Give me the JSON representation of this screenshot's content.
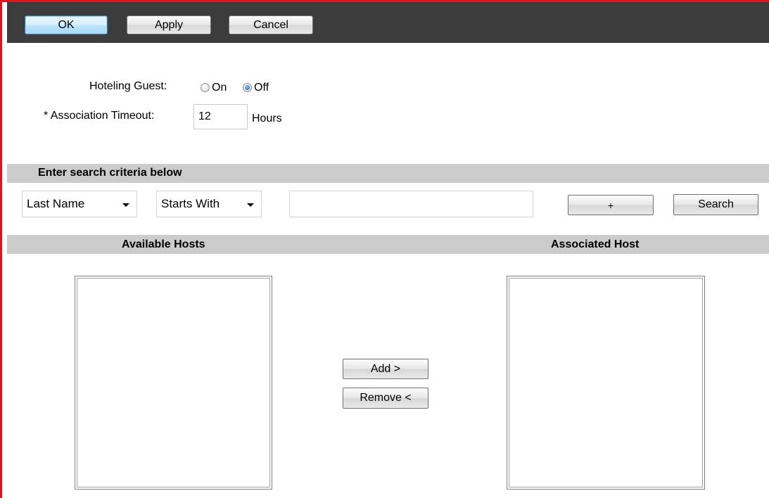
{
  "toolbar": {
    "ok_label": "OK",
    "apply_label": "Apply",
    "cancel_label": "Cancel"
  },
  "settings": {
    "hoteling_guest_label": "Hoteling Guest:",
    "hoteling_guest_options": [
      "On",
      "Off"
    ],
    "hoteling_guest_selected": "Off",
    "association_timeout_label": "* Association Timeout:",
    "association_timeout_value": "12",
    "association_timeout_unit": "Hours"
  },
  "search": {
    "header": "Enter search criteria below",
    "field_selected": "Last Name",
    "operator_selected": "Starts With",
    "query_value": "",
    "plus_label": "+",
    "search_label": "Search"
  },
  "hosts": {
    "available_header": "Available Hosts",
    "associated_header": "Associated Host",
    "available_items": [],
    "associated_items": [],
    "add_label": "Add >",
    "remove_label": "Remove <"
  },
  "colors": {
    "frame_border": "#e0121b",
    "toolbar_bg": "#3c3c3c",
    "section_bar_bg": "#cccccc"
  }
}
